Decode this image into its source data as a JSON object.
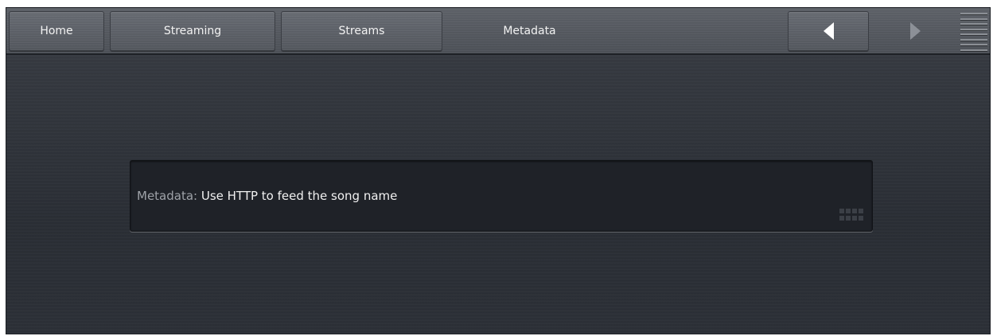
{
  "nav": {
    "tabs": [
      {
        "label": "Home"
      },
      {
        "label": "Streaming"
      },
      {
        "label": "Streams"
      },
      {
        "label": "Metadata",
        "active": true
      }
    ],
    "back_icon": "triangle-left-icon",
    "forward_icon": "triangle-right-icon",
    "menu_icon": "hamburger-menu-icon"
  },
  "main": {
    "field": {
      "label": "Metadata:",
      "value": "Use HTTP to feed the song name",
      "grip_icon": "resize-grip-icon"
    }
  },
  "colors": {
    "background": "#2d3138",
    "tab_bar": "#50545b",
    "field_bg": "#1f2228",
    "text": "#f0f0f0",
    "label_text": "#9ea2a8"
  }
}
